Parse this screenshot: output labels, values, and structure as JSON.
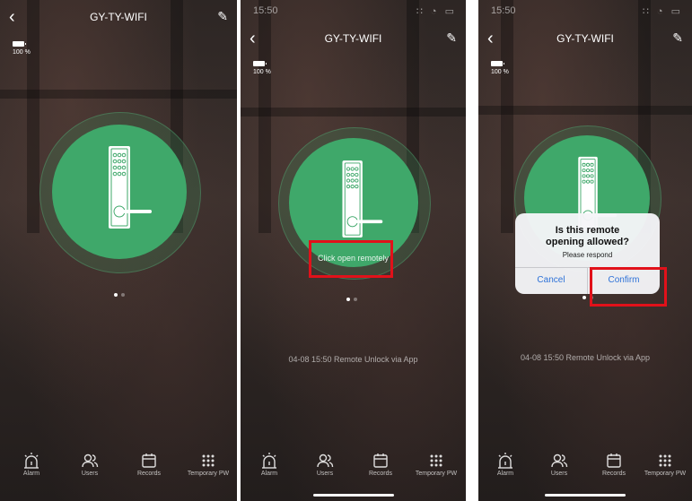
{
  "screens": [
    {
      "title": "GY-TY-WIFI",
      "battery_text": "100 %",
      "tabs": [
        "Alarm",
        "Users",
        "Records",
        "Temporary PW"
      ]
    },
    {
      "status_time": "15:50",
      "title": "GY-TY-WIFI",
      "battery_text": "100 %",
      "open_button": "Click open remotely",
      "log_text": "04-08 15:50  Remote Unlock via App",
      "tabs": [
        "Alarm",
        "Users",
        "Records",
        "Temporary PW"
      ]
    },
    {
      "status_time": "15:50",
      "title": "GY-TY-WIFI",
      "battery_text": "100 %",
      "dialog": {
        "title_line1": "Is this remote",
        "title_line2": "opening allowed?",
        "message": "Please respond",
        "cancel": "Cancel",
        "confirm": "Confirm"
      },
      "log_text": "04-08 15:50  Remote Unlock via App",
      "tabs": [
        "Alarm",
        "Users",
        "Records",
        "Temporary PW"
      ]
    }
  ],
  "colors": {
    "lock_green": "#3fa86a",
    "highlight_red": "#e1111a",
    "dialog_blue": "#2e72d8"
  },
  "icons": [
    "back-arrow-icon",
    "edit-pencil-icon",
    "battery-icon",
    "door-lock-icon",
    "alarm-icon",
    "users-icon",
    "calendar-icon",
    "keypad-icon"
  ]
}
